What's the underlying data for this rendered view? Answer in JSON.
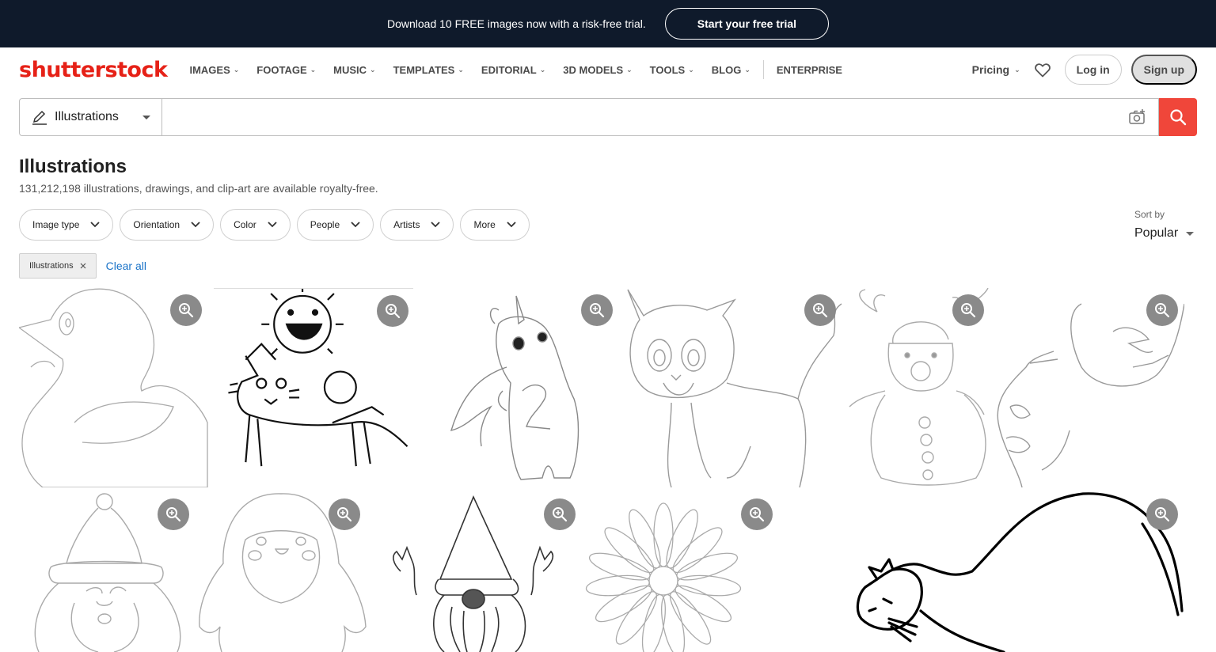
{
  "promo": {
    "text": "Download 10 FREE images now with a risk-free trial.",
    "cta": "Start your free trial"
  },
  "header": {
    "logo": "shutterstock",
    "nav": [
      "IMAGES",
      "FOOTAGE",
      "MUSIC",
      "TEMPLATES",
      "EDITORIAL",
      "3D MODELS",
      "TOOLS",
      "BLOG"
    ],
    "enterprise": "ENTERPRISE",
    "pricing": "Pricing",
    "login": "Log in",
    "signup": "Sign up"
  },
  "search": {
    "type": "Illustrations",
    "value": "",
    "placeholder": ""
  },
  "page": {
    "title": "Illustrations",
    "subtitle": "131,212,198 illustrations, drawings, and clip-art are available royalty-free."
  },
  "filters": [
    "Image type",
    "Orientation",
    "Color",
    "People",
    "Artists",
    "More"
  ],
  "sort": {
    "label": "Sort by",
    "value": "Popular"
  },
  "chips": {
    "active": "Illustrations",
    "clear": "Clear all"
  },
  "colors": {
    "accent": "#f0463a",
    "promo_bg": "#0f1a2b",
    "link": "#1a73c8"
  },
  "icons": {
    "search_type": "pen-icon",
    "visual_search": "camera-search-icon",
    "search": "search-icon",
    "favorites": "heart-icon",
    "tile_action": "zoom-in-icon"
  },
  "results": [
    {
      "subject": "duck"
    },
    {
      "subject": "sun-riding-cat"
    },
    {
      "subject": "unicorn"
    },
    {
      "subject": "kitten"
    },
    {
      "subject": "reindeer-snowman"
    },
    {
      "subject": "line-faces"
    },
    {
      "subject": "santa"
    },
    {
      "subject": "penguin"
    },
    {
      "subject": "gnome"
    },
    {
      "subject": "daisy"
    },
    {
      "subject": "cat"
    }
  ]
}
